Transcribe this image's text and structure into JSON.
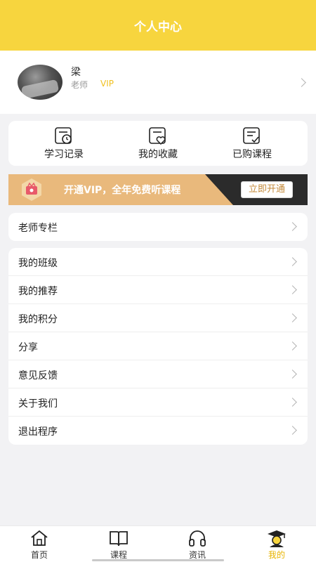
{
  "header": {
    "title": "个人中心"
  },
  "profile": {
    "name": "梁",
    "role": "老师",
    "vip": "VIP"
  },
  "quick_actions": [
    {
      "label": "学习记录",
      "icon": "study-record-icon"
    },
    {
      "label": "我的收藏",
      "icon": "favorites-icon"
    },
    {
      "label": "已购课程",
      "icon": "purchased-courses-icon"
    }
  ],
  "vip_banner": {
    "text": "开通VIP，全年免费听课程",
    "button": "立即开通"
  },
  "teacher_column": {
    "label": "老师专栏"
  },
  "menu": [
    {
      "label": "我的班级"
    },
    {
      "label": "我的推荐"
    },
    {
      "label": "我的积分"
    },
    {
      "label": "分享"
    },
    {
      "label": "意见反馈"
    },
    {
      "label": "关于我们"
    },
    {
      "label": "退出程序"
    }
  ],
  "tabbar": [
    {
      "label": "首页",
      "icon": "home-icon"
    },
    {
      "label": "课程",
      "icon": "book-icon"
    },
    {
      "label": "资讯",
      "icon": "headphones-icon"
    },
    {
      "label": "我的",
      "icon": "graduate-icon",
      "active": true
    }
  ],
  "colors": {
    "accent": "#f7d53e",
    "vip_gold": "#e9b97c",
    "vip_dark": "#2b2b2b",
    "active_tab": "#e8b400"
  }
}
